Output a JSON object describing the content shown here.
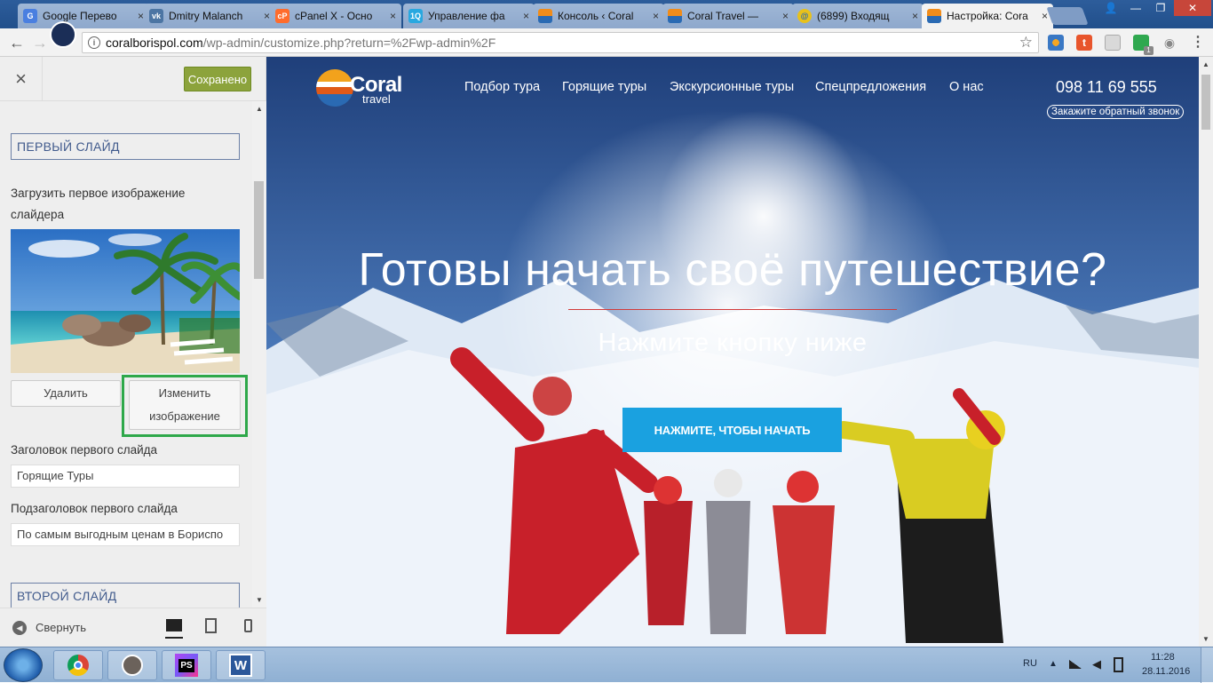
{
  "browser": {
    "tabs": [
      {
        "title": "Google Перево",
        "close": "×",
        "fav_color": "#4a7fe0",
        "fav_text": "G"
      },
      {
        "title": "Dmitry Malanch",
        "close": "×",
        "fav_color": "#4c75a3",
        "fav_text": "vk"
      },
      {
        "title": "cPanel X - Осно",
        "close": "×",
        "fav_color": "#ff6c2c",
        "fav_text": "cP"
      },
      {
        "title": "Управление фа",
        "close": "×",
        "fav_color": "#29a8e0",
        "fav_text": "1Q"
      },
      {
        "title": "Консоль ‹ Coral",
        "close": "×",
        "fav_color": "#f08c1a",
        "fav_text": ""
      },
      {
        "title": "Coral Travel — ",
        "close": "×",
        "fav_color": "#f08c1a",
        "fav_text": ""
      },
      {
        "title": "(6899) Входящ",
        "close": "×",
        "fav_color": "#e8c11a",
        "fav_text": "@"
      },
      {
        "title": "Настройка: Cora",
        "close": "×",
        "fav_color": "#f08c1a",
        "fav_text": ""
      }
    ],
    "window_controls": {
      "user": "👤",
      "minimize": "—",
      "restore": "❐",
      "close": "✕"
    },
    "url_host": "coralborispol.com",
    "url_path": "/wp-admin/customize.php?return=%2Fwp-admin%2F",
    "ext_badge": "1"
  },
  "customizer": {
    "close_icon": "×",
    "saved_label": "Сохранено",
    "section1_title": "ПЕРВЫЙ СЛАЙД",
    "upload_label": "Загрузить первое изображение слайдера",
    "remove_label": "Удалить",
    "change_label": "Изменить изображение",
    "heading_label": "Заголовок первого слайда",
    "heading_value": "Горящие Туры",
    "subheading_label": "Подзаголовок первого слайда",
    "subheading_value": "По самым выгодным ценам в Бориспо",
    "section2_title": "ВТОРОЙ СЛАЙД",
    "collapse_label": "Свернуть"
  },
  "site": {
    "logo_main": "Coral",
    "logo_sub": "travel",
    "nav": [
      "Подбор тура",
      "Горящие туры",
      "Экскурсионные туры",
      "Спецпредложения",
      "О нас"
    ],
    "phone": "098 11 69 555",
    "callback": "Закажите обратный звонок",
    "hero_title": "Готовы начать своё путешествие?",
    "hero_subtitle": "Нажмите кнопку ниже",
    "cta": "НАЖМИТЕ, ЧТОБЫ НАЧАТЬ",
    "accent": "#1aa1e0"
  },
  "taskbar": {
    "lang": "RU",
    "time": "11:28",
    "date": "28.11.2016",
    "apps": [
      "chrome",
      "gimp",
      "phpstorm",
      "word"
    ],
    "phpstorm_label": "PS",
    "word_label": "W"
  }
}
